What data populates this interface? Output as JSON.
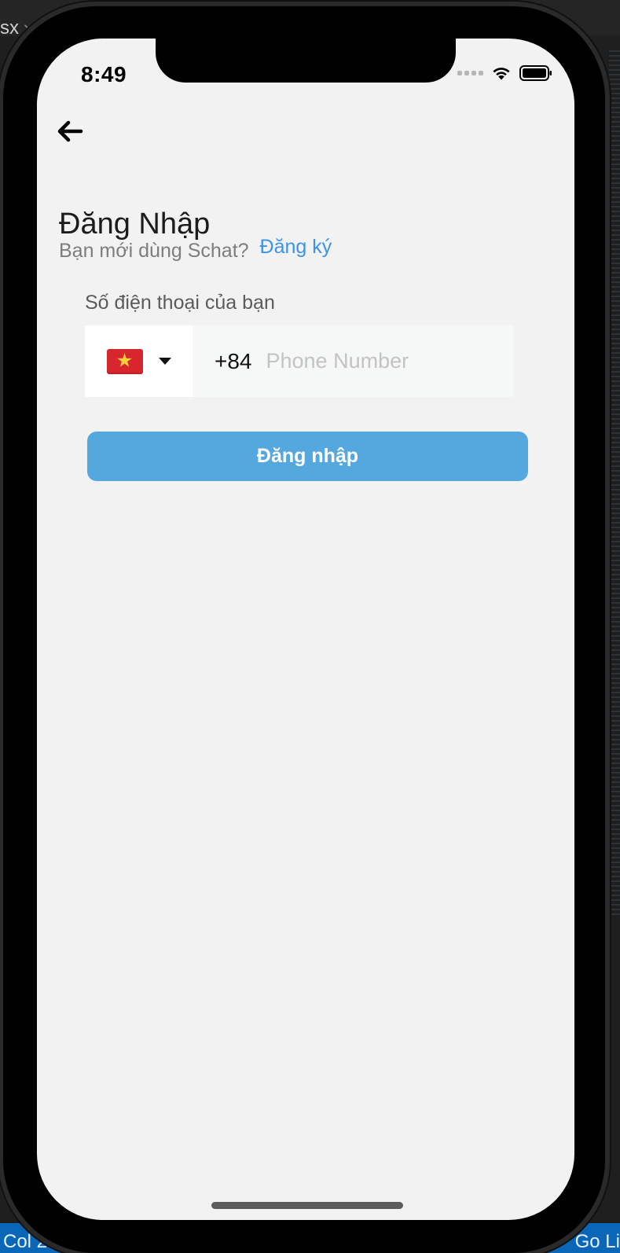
{
  "editor": {
    "tab_fragment": "sx",
    "tab_chevron": "›",
    "status_left": "Col 2",
    "status_right": "Go Li"
  },
  "status_bar": {
    "time": "8:49",
    "icons": [
      "signal-icon",
      "wifi-icon",
      "battery-icon"
    ]
  },
  "nav": {
    "back_icon": "arrow-left-icon"
  },
  "login": {
    "title": "Đăng Nhập",
    "signup_prompt": "Bạn mới dùng Schat?",
    "signup_link": "Đăng ký",
    "phone_label": "Số điện thoại của bạn",
    "country_flag": "vietnam-flag-icon",
    "dial_code": "+84",
    "phone_value": "",
    "phone_placeholder": "Phone Number",
    "submit_label": "Đăng nhập"
  },
  "colors": {
    "screen_background": "#f2f2f2",
    "link_blue": "#3d93e8",
    "button_blue": "#55a8de",
    "flag_red": "#d8262f",
    "flag_star": "#f7d13a",
    "vscode_status_blue": "#0a66b7"
  }
}
